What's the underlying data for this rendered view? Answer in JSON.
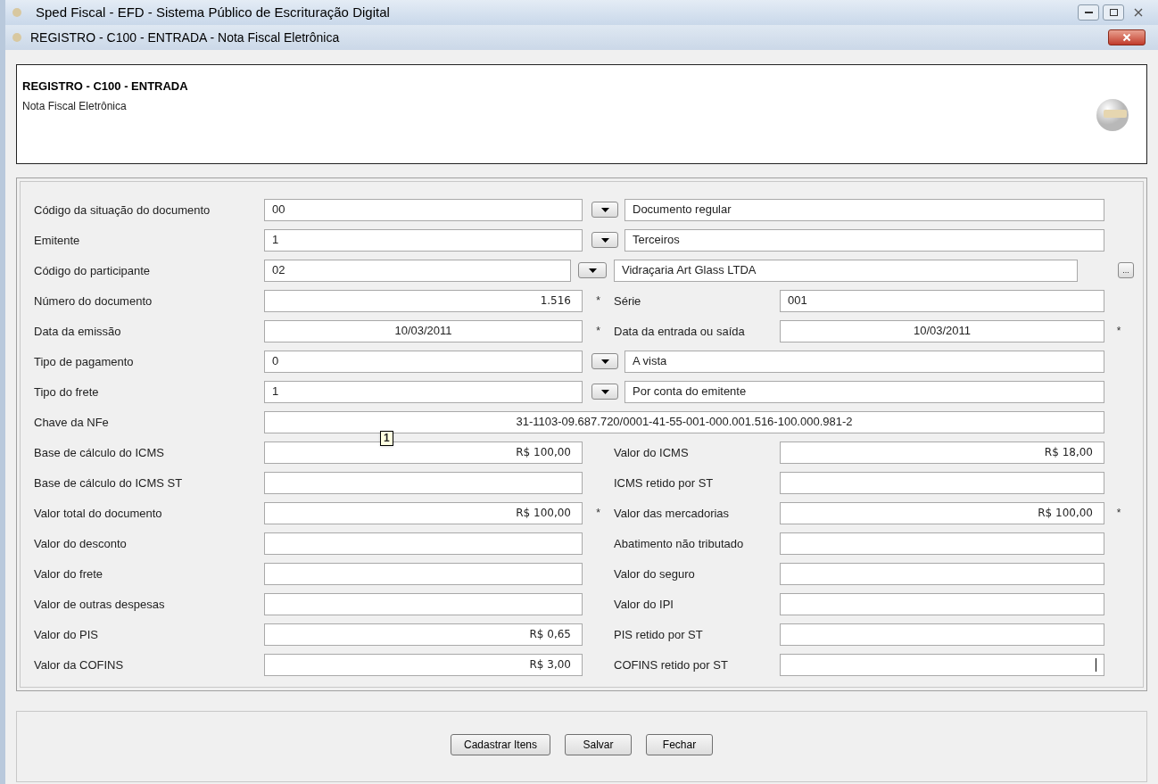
{
  "app_window": {
    "title": "Sped Fiscal - EFD - Sistema Público de Escrituração Digital"
  },
  "dialog": {
    "title": "REGISTRO - C100 - ENTRADA - Nota Fiscal Eletrônica"
  },
  "header": {
    "title": "REGISTRO - C100 - ENTRADA",
    "subtitle": "Nota Fiscal Eletrônica"
  },
  "rows": [
    {
      "kind": "combo",
      "label": "Código da situação do documento",
      "value": "00",
      "description": "Documento regular"
    },
    {
      "kind": "combo",
      "label": "Emitente",
      "value": "1",
      "description": "Terceiros"
    },
    {
      "kind": "combo",
      "label": "Código do participante",
      "value": "02",
      "description": "Vidraçaria Art Glass LTDA",
      "lookup_label": "..."
    },
    {
      "kind": "pair",
      "left": {
        "label": "Número do documento",
        "value": "1.516",
        "kind": "number",
        "marker": "*"
      },
      "right": {
        "label": "Série",
        "value": "001",
        "kind": "text"
      }
    },
    {
      "kind": "pair",
      "left": {
        "label": "Data da emissão",
        "value": "10/03/2011",
        "kind": "date",
        "marker": "*"
      },
      "right": {
        "label": "Data da entrada ou saída",
        "value": "10/03/2011",
        "kind": "date",
        "marker": "*"
      }
    },
    {
      "kind": "combo",
      "label": "Tipo de pagamento",
      "value": "0",
      "description": "A vista"
    },
    {
      "kind": "combo",
      "label": "Tipo do frete",
      "value": "1",
      "description": "Por conta do emitente"
    },
    {
      "kind": "wide",
      "label": "Chave da NFe",
      "value": "31-1103-09.687.720/0001-41-55-001-000.001.516-100.000.981-2",
      "tooltip": "1"
    },
    {
      "kind": "pair",
      "left": {
        "label": "Base de cálculo do ICMS",
        "value": "R$ 100,00",
        "kind": "money"
      },
      "right": {
        "label": "Valor do ICMS",
        "value": "R$ 18,00",
        "kind": "money"
      }
    },
    {
      "kind": "pair",
      "left": {
        "label": "Base de cálculo do ICMS ST"
      },
      "right": {
        "label": "ICMS retido por ST"
      }
    },
    {
      "kind": "pair",
      "left": {
        "label": "Valor total do documento",
        "value": "R$ 100,00",
        "kind": "money",
        "marker": "*"
      },
      "right": {
        "label": "Valor das mercadorias",
        "value": "R$ 100,00",
        "kind": "money",
        "marker": "*"
      }
    },
    {
      "kind": "pair",
      "left": {
        "label": "Valor do desconto"
      },
      "right": {
        "label": "Abatimento não tributado"
      }
    },
    {
      "kind": "pair",
      "left": {
        "label": "Valor do frete"
      },
      "right": {
        "label": "Valor do seguro"
      }
    },
    {
      "kind": "pair",
      "left": {
        "label": "Valor de outras despesas"
      },
      "right": {
        "label": "Valor do IPI"
      }
    },
    {
      "kind": "pair",
      "left": {
        "label": "Valor do PIS",
        "value": "R$ 0,65",
        "kind": "money"
      },
      "right": {
        "label": "PIS retido por ST"
      }
    },
    {
      "kind": "pair",
      "left": {
        "label": "Valor da COFINS",
        "value": "R$ 3,00",
        "kind": "money"
      },
      "right": {
        "label": "COFINS retido por ST",
        "focused": true
      }
    }
  ],
  "buttons": [
    "Cadastrar Itens",
    "Salvar",
    "Fechar"
  ]
}
